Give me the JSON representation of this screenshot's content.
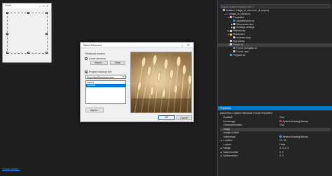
{
  "form": {
    "title": "Form1"
  },
  "solution_explorer": {
    "search_placeholder": "Search Solution Explorer (Ctrl+;)",
    "items": [
      {
        "label": "Solution 'image_in_resource' (1 project)",
        "icon": "solution-icon",
        "indent": 0,
        "arrow": "",
        "selected": false,
        "icon_color": "#c5a5ff"
      },
      {
        "label": "image_in_resource",
        "icon": "csharp-project-icon",
        "indent": 1,
        "arrow": "▲",
        "selected": false,
        "icon_color": "#68217a"
      },
      {
        "label": "Properties",
        "icon": "wrench-icon",
        "indent": 2,
        "arrow": "▲",
        "selected": false,
        "icon_color": "#c8c8c8"
      },
      {
        "label": "AssemblyInfo.cs",
        "icon": "csharp-file-icon",
        "indent": 3,
        "arrow": "",
        "selected": false,
        "icon_color": "#3a9bdc"
      },
      {
        "label": "Resources.resx",
        "icon": "resx-icon",
        "indent": 3,
        "arrow": "▶",
        "selected": false,
        "icon_color": "#c8c8c8"
      },
      {
        "label": "Settings.settings",
        "icon": "settings-icon",
        "indent": 3,
        "arrow": "▶",
        "selected": false,
        "icon_color": "#c8c8c8"
      },
      {
        "label": "References",
        "icon": "references-icon",
        "indent": 2,
        "arrow": "▶",
        "selected": false,
        "icon_color": "#c8c8c8"
      },
      {
        "label": "Resources",
        "icon": "folder-icon",
        "indent": 2,
        "arrow": "▲",
        "selected": false,
        "icon_color": "#dcb67a"
      },
      {
        "label": "summer.bmp",
        "icon": "image-file-icon",
        "indent": 3,
        "arrow": "",
        "selected": false,
        "icon_color": "#c8c8c8"
      },
      {
        "label": "App.config",
        "icon": "config-file-icon",
        "indent": 2,
        "arrow": "",
        "selected": false,
        "icon_color": "#c8c8c8"
      },
      {
        "label": "Form1.cs",
        "icon": "form-icon",
        "indent": 2,
        "arrow": "▲",
        "selected": true,
        "icon_color": "#dcdcdc"
      },
      {
        "label": "Form1.Designer.cs",
        "icon": "csharp-file-icon",
        "indent": 3,
        "arrow": "",
        "selected": false,
        "icon_color": "#3a9bdc"
      },
      {
        "label": "Form1.resx",
        "icon": "resx-icon",
        "indent": 3,
        "arrow": "",
        "selected": false,
        "icon_color": "#c8c8c8"
      },
      {
        "label": "Program.cs",
        "icon": "csharp-file-icon",
        "indent": 2,
        "arrow": "",
        "selected": false,
        "icon_color": "#3a9bdc"
      }
    ]
  },
  "properties": {
    "title": "Properties",
    "object": "pictureBox1 System.Windows.Forms.PictureBox",
    "rows": [
      {
        "name": "Enabled",
        "value": "True",
        "expand": "",
        "icon": "",
        "selected": false
      },
      {
        "name": "ErrorImage",
        "value": "System.Drawing.Bitmap",
        "expand": "",
        "icon": "error-image-icon",
        "selected": false
      },
      {
        "name": "GenerateMember",
        "value": "True",
        "expand": "",
        "icon": "",
        "selected": false
      },
      {
        "name": "Image",
        "value": "",
        "expand": "",
        "icon": "",
        "selected": true
      },
      {
        "name": "ImageLocation",
        "value": "",
        "expand": "",
        "icon": "",
        "selected": false
      },
      {
        "name": "InitialImage",
        "value": "System.Drawing.Bitmap",
        "expand": "",
        "icon": "initial-image-icon",
        "selected": false
      },
      {
        "name": "Location",
        "value": "19, 18",
        "expand": "▶",
        "icon": "",
        "selected": false
      },
      {
        "name": "Locked",
        "value": "False",
        "expand": "",
        "icon": "",
        "selected": false
      },
      {
        "name": "Margin",
        "value": "3, 3, 3, 3",
        "expand": "▶",
        "icon": "",
        "selected": false
      },
      {
        "name": "MaximumSize",
        "value": "0, 0",
        "expand": "▶",
        "icon": "",
        "selected": false
      },
      {
        "name": "MinimumSize",
        "value": "0, 0",
        "expand": "▶",
        "icon": "",
        "selected": false
      }
    ],
    "link": "Choose Image..."
  },
  "dialog": {
    "title": "Select Resource",
    "help": "?",
    "close": "✕",
    "resource_context_label": "Resource context",
    "local_resource_label": "Local resource:",
    "local_import_label": "Import...",
    "clear_label": "Clear",
    "project_resource_label": "Project resource file:",
    "resx_file": "Properties\\Resources.resx",
    "list_items": [
      {
        "label": "(none)",
        "selected": false
      },
      {
        "label": "summer",
        "selected": true
      }
    ],
    "import_label": "Import...",
    "ok_label": "OK",
    "cancel_label": "Cancel",
    "local_selected": false,
    "project_selected": true
  }
}
